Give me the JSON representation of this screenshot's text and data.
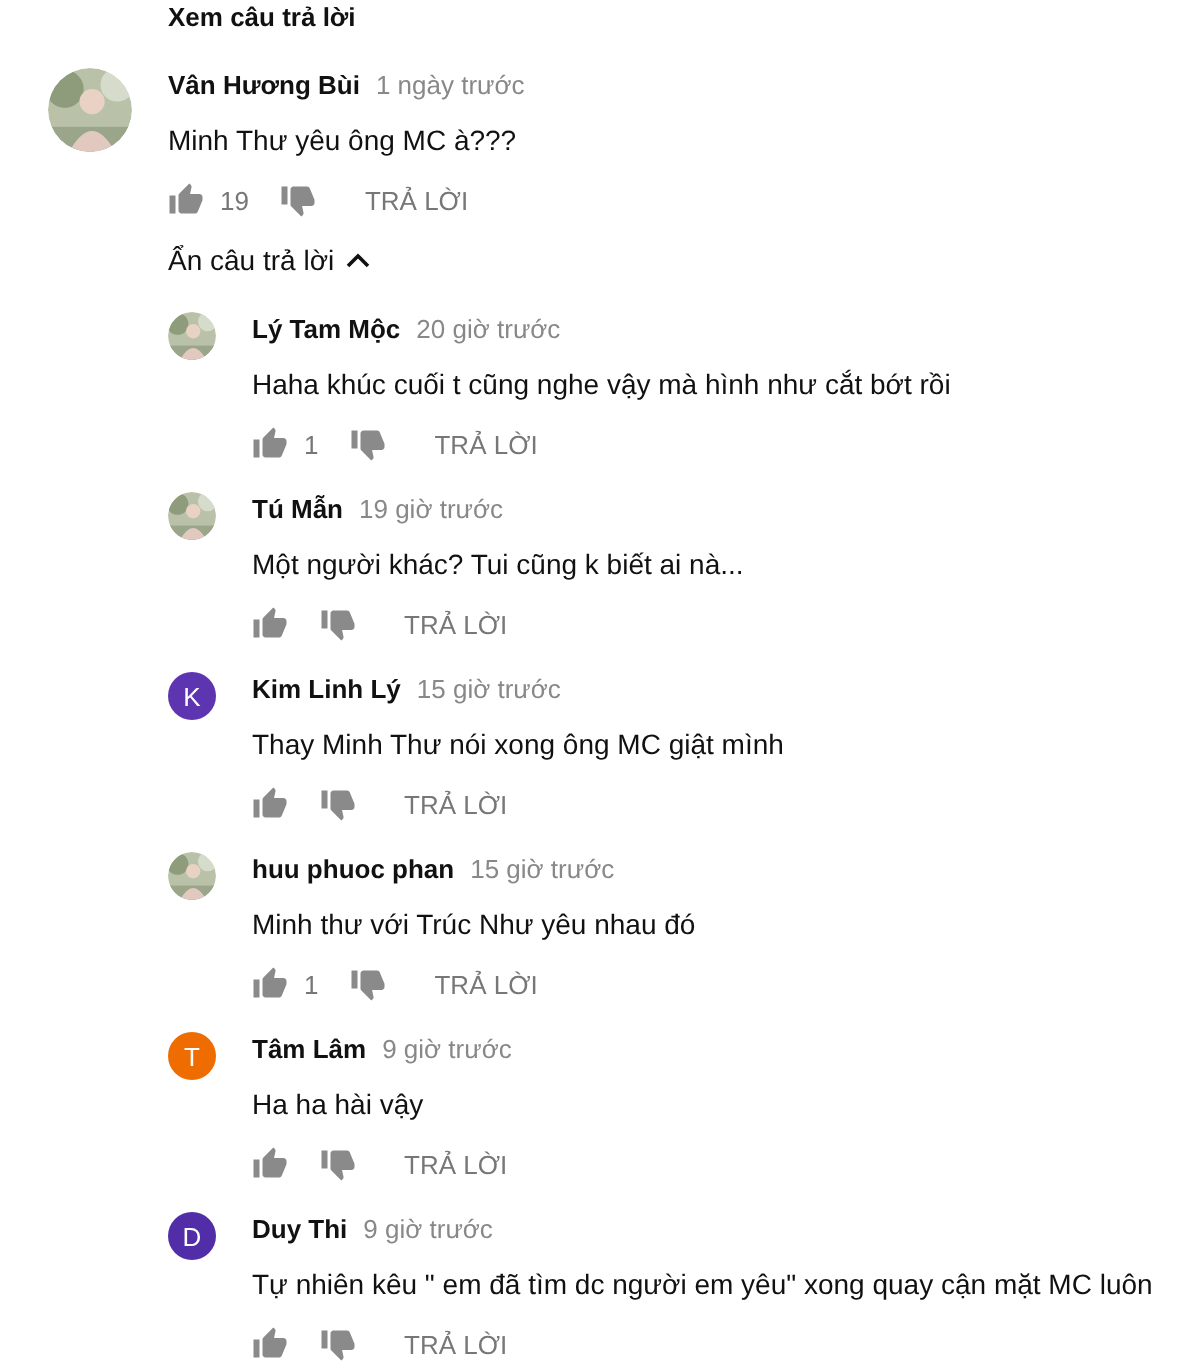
{
  "top_link": "Xem câu trả lời",
  "comment": {
    "author": "Vân Hương Bùi",
    "time": "1 ngày trước",
    "text": "Minh Thư yêu ông MC à???",
    "likes": "19",
    "reply": "TRẢ LỜI"
  },
  "toggle_replies": {
    "label": "Ẩn câu trả lời",
    "expanded": true
  },
  "replies": [
    {
      "author": "Lý Tam Mộc",
      "time": "20 giờ trước",
      "text": "Haha khúc cuối t cũng nghe vậy mà hình như cắt bớt rồi",
      "likes": "1",
      "reply": "TRẢ LỜI"
    },
    {
      "author": "Tú Mẫn",
      "time": "19 giờ trước",
      "text": "Một người khác? Tui cũng k biết ai nà...",
      "reply": "TRẢ LỜI"
    },
    {
      "avatar": {
        "kind": "letter",
        "letter": "K",
        "color": "#5e35b1"
      },
      "author": "Kim Linh Lý",
      "time": "15 giờ trước",
      "text": "Thay Minh Thư nói xong ông MC giật mình",
      "reply": "TRẢ LỜI"
    },
    {
      "author": "huu phuoc phan",
      "time": "15 giờ trước",
      "text": "Minh thư với Trúc Như yêu nhau đó",
      "likes": "1",
      "reply": "TRẢ LỜI"
    },
    {
      "avatar": {
        "kind": "letter",
        "letter": "T",
        "color": "#ef6c00"
      },
      "author": "Tâm Lâm",
      "time": "9 giờ trước",
      "text": "Ha ha hài vậy",
      "reply": "TRẢ LỜI"
    },
    {
      "avatar": {
        "kind": "letter",
        "letter": "D",
        "color": "#512da8"
      },
      "author": "Duy Thi",
      "time": "9 giờ trước",
      "text": "Tự nhiên kêu \" em đã tìm dc người em yêu\" xong quay cận mặt MC luôn",
      "reply": "TRẢ LỜI"
    }
  ]
}
